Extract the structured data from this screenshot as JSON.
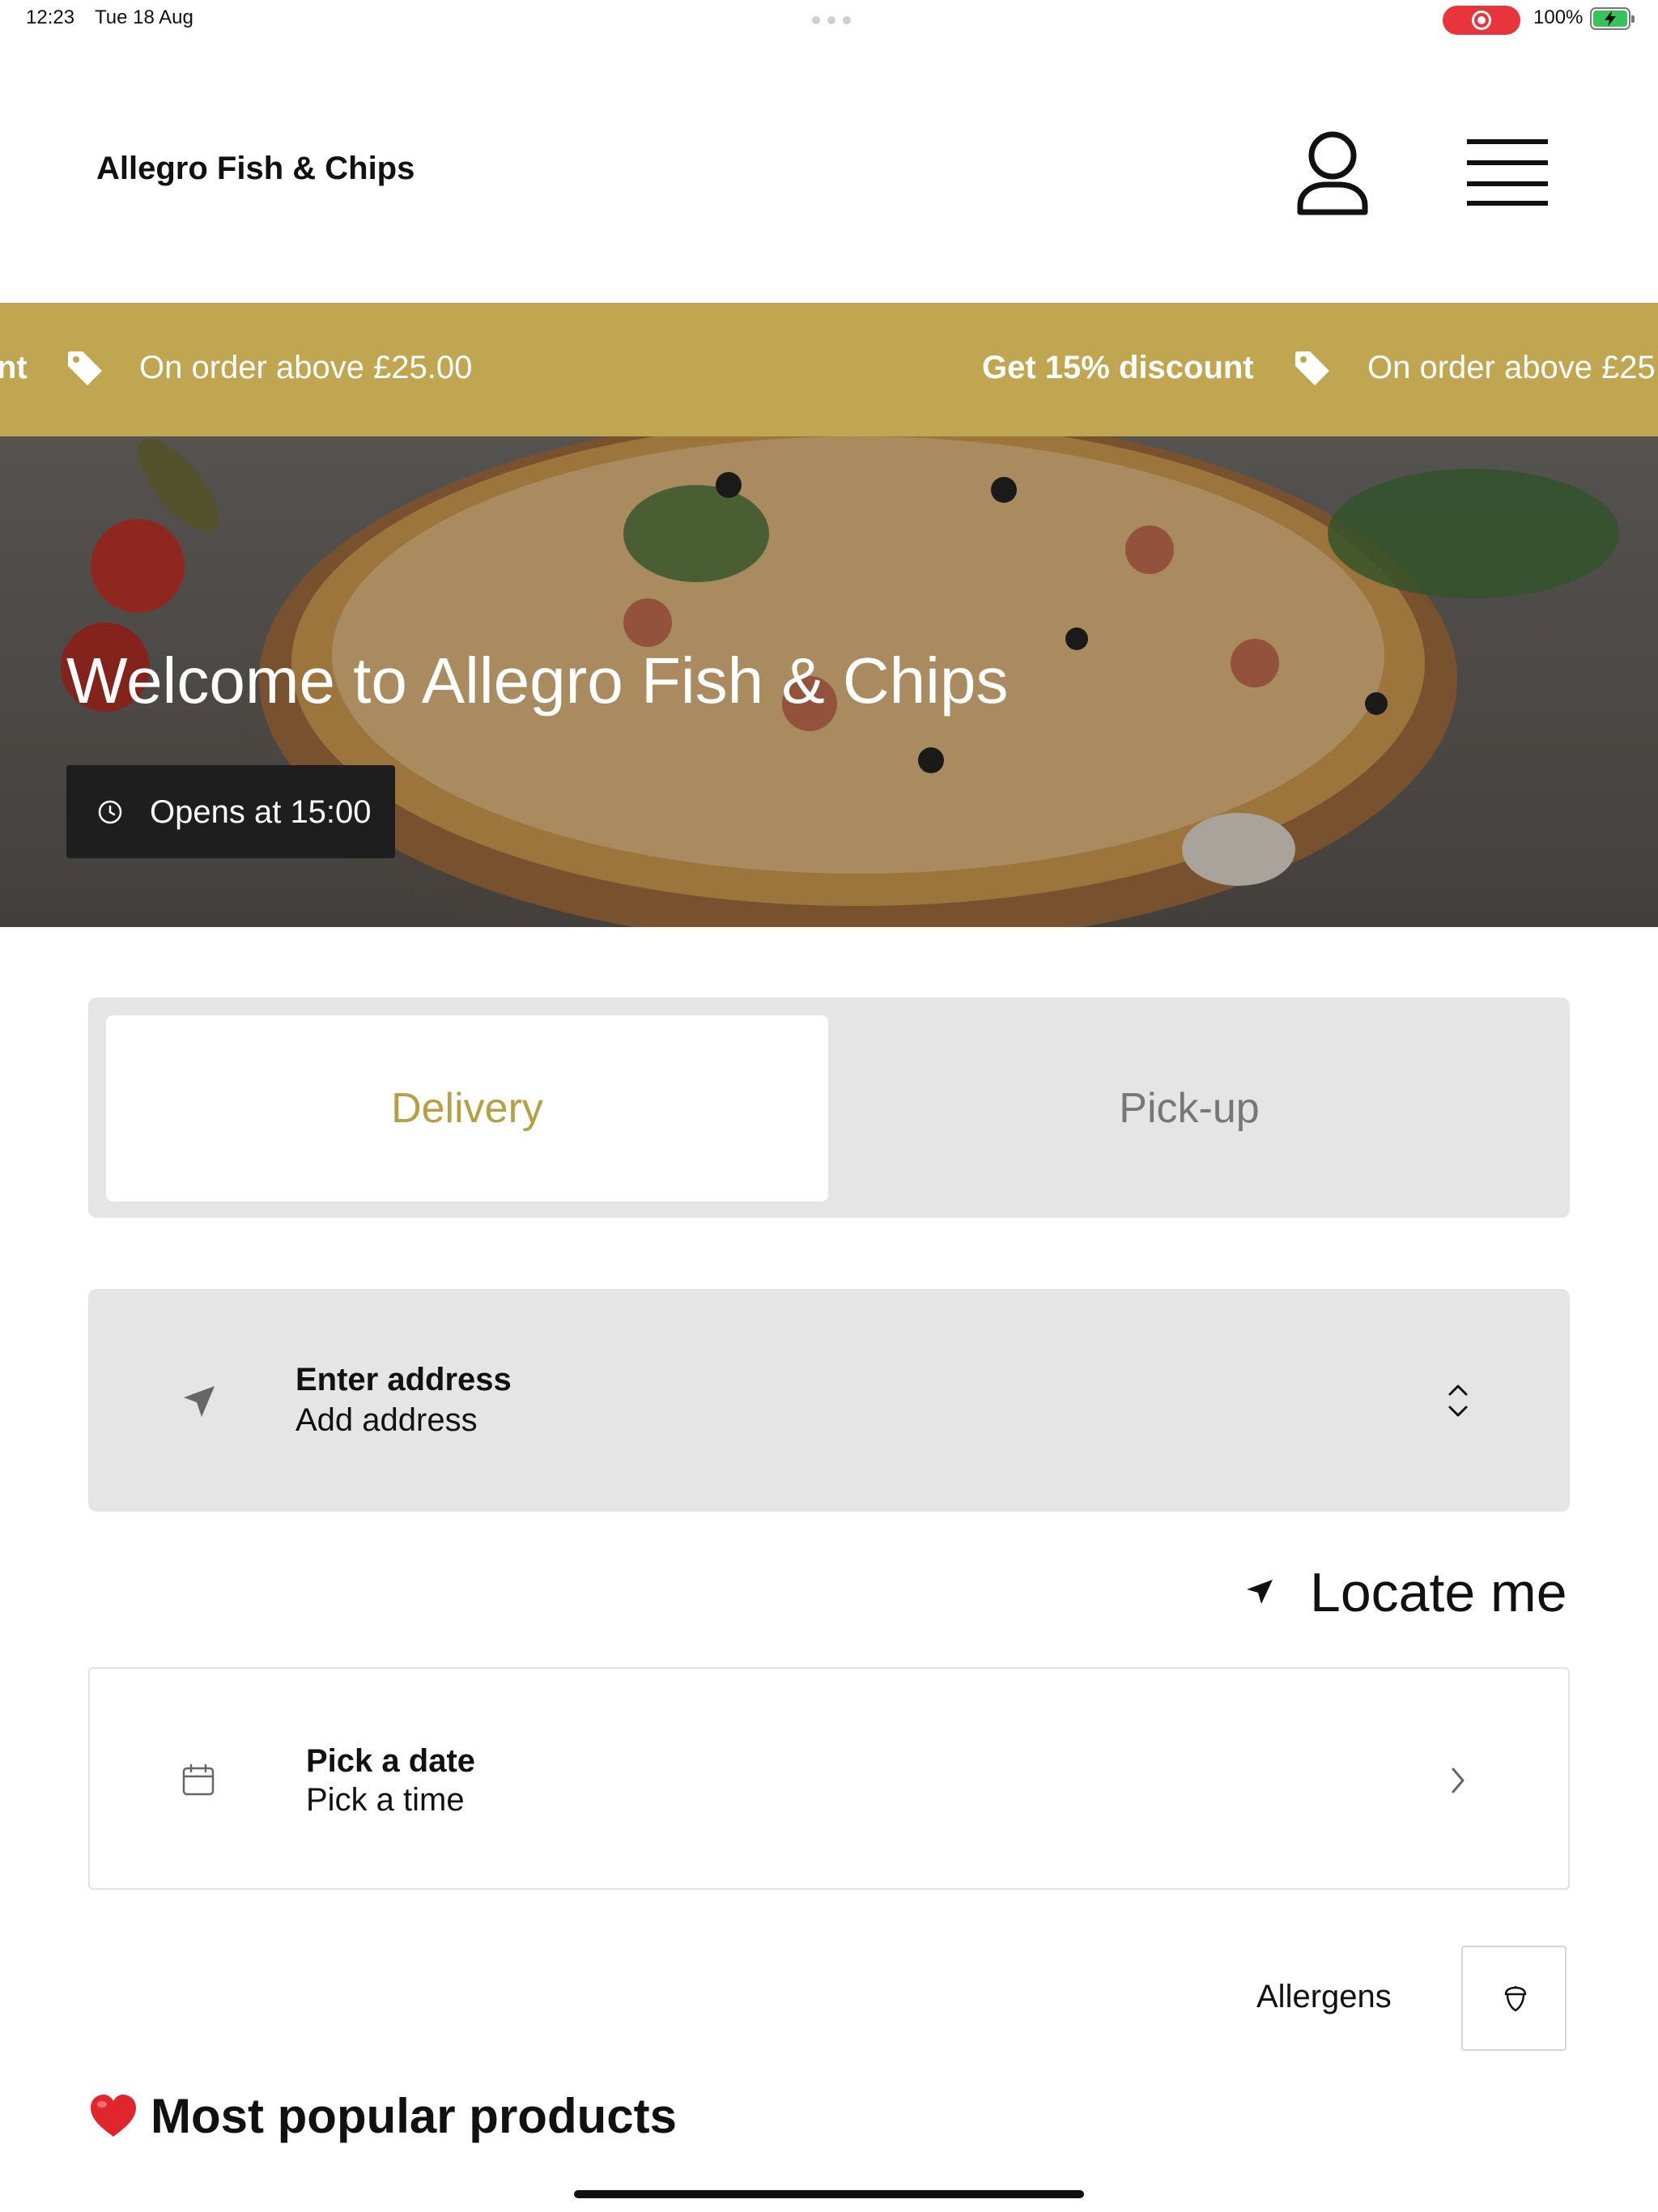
{
  "status_bar": {
    "time": "12:23",
    "date": "Tue 18 Aug",
    "battery": "100%"
  },
  "header": {
    "brand": "Allegro Fish & Chips",
    "account_icon": "user-icon",
    "menu_icon": "hamburger-menu-icon"
  },
  "promo": {
    "items": [
      {
        "text": "nt",
        "bold": true
      },
      {
        "text": "On order above £25.00",
        "bold": false
      },
      {
        "text": "Get 15% discount",
        "bold": true
      },
      {
        "text": "On order above £25",
        "bold": false
      }
    ],
    "tag_icon": "tag-icon",
    "color": "#c0a650"
  },
  "hero": {
    "title": "Welcome to Allegro Fish & Chips",
    "hours": "Opens at 15:00"
  },
  "order_type": {
    "tabs": [
      "Delivery",
      "Pick-up"
    ],
    "selected": "Delivery",
    "accent": "#b7a044"
  },
  "address": {
    "title": "Enter address",
    "subtitle": "Add address"
  },
  "locate": {
    "label": "Locate me"
  },
  "schedule": {
    "title": "Pick a date",
    "subtitle": "Pick a time"
  },
  "allergens": {
    "label": "Allergens"
  },
  "section": {
    "title": "Most popular products",
    "emoji_icon": "heart-icon"
  }
}
